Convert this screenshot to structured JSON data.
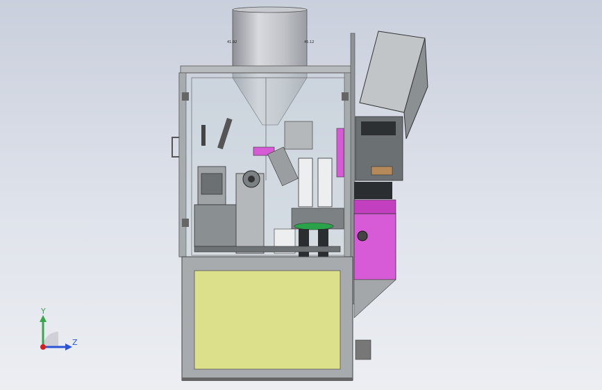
{
  "viewport": {
    "background_top": "#c9cfdc",
    "background_bottom": "#eceef2"
  },
  "model": {
    "hopper_label_left": "41.92",
    "hopper_label_right": "45.12",
    "colors": {
      "frame": "#9aa0a4",
      "panel": "#dde08a",
      "magenta": "#d75bd6",
      "glass": "#c5d0d6",
      "dark": "#2a2e30",
      "hopper_light": "#d8dadf",
      "hopper_dark": "#8e9097"
    }
  },
  "triad": {
    "y_label": "Y",
    "z_label": "Z",
    "y_color": "#3aa64a",
    "z_color": "#2a55d6",
    "origin_color": "#d42020"
  }
}
